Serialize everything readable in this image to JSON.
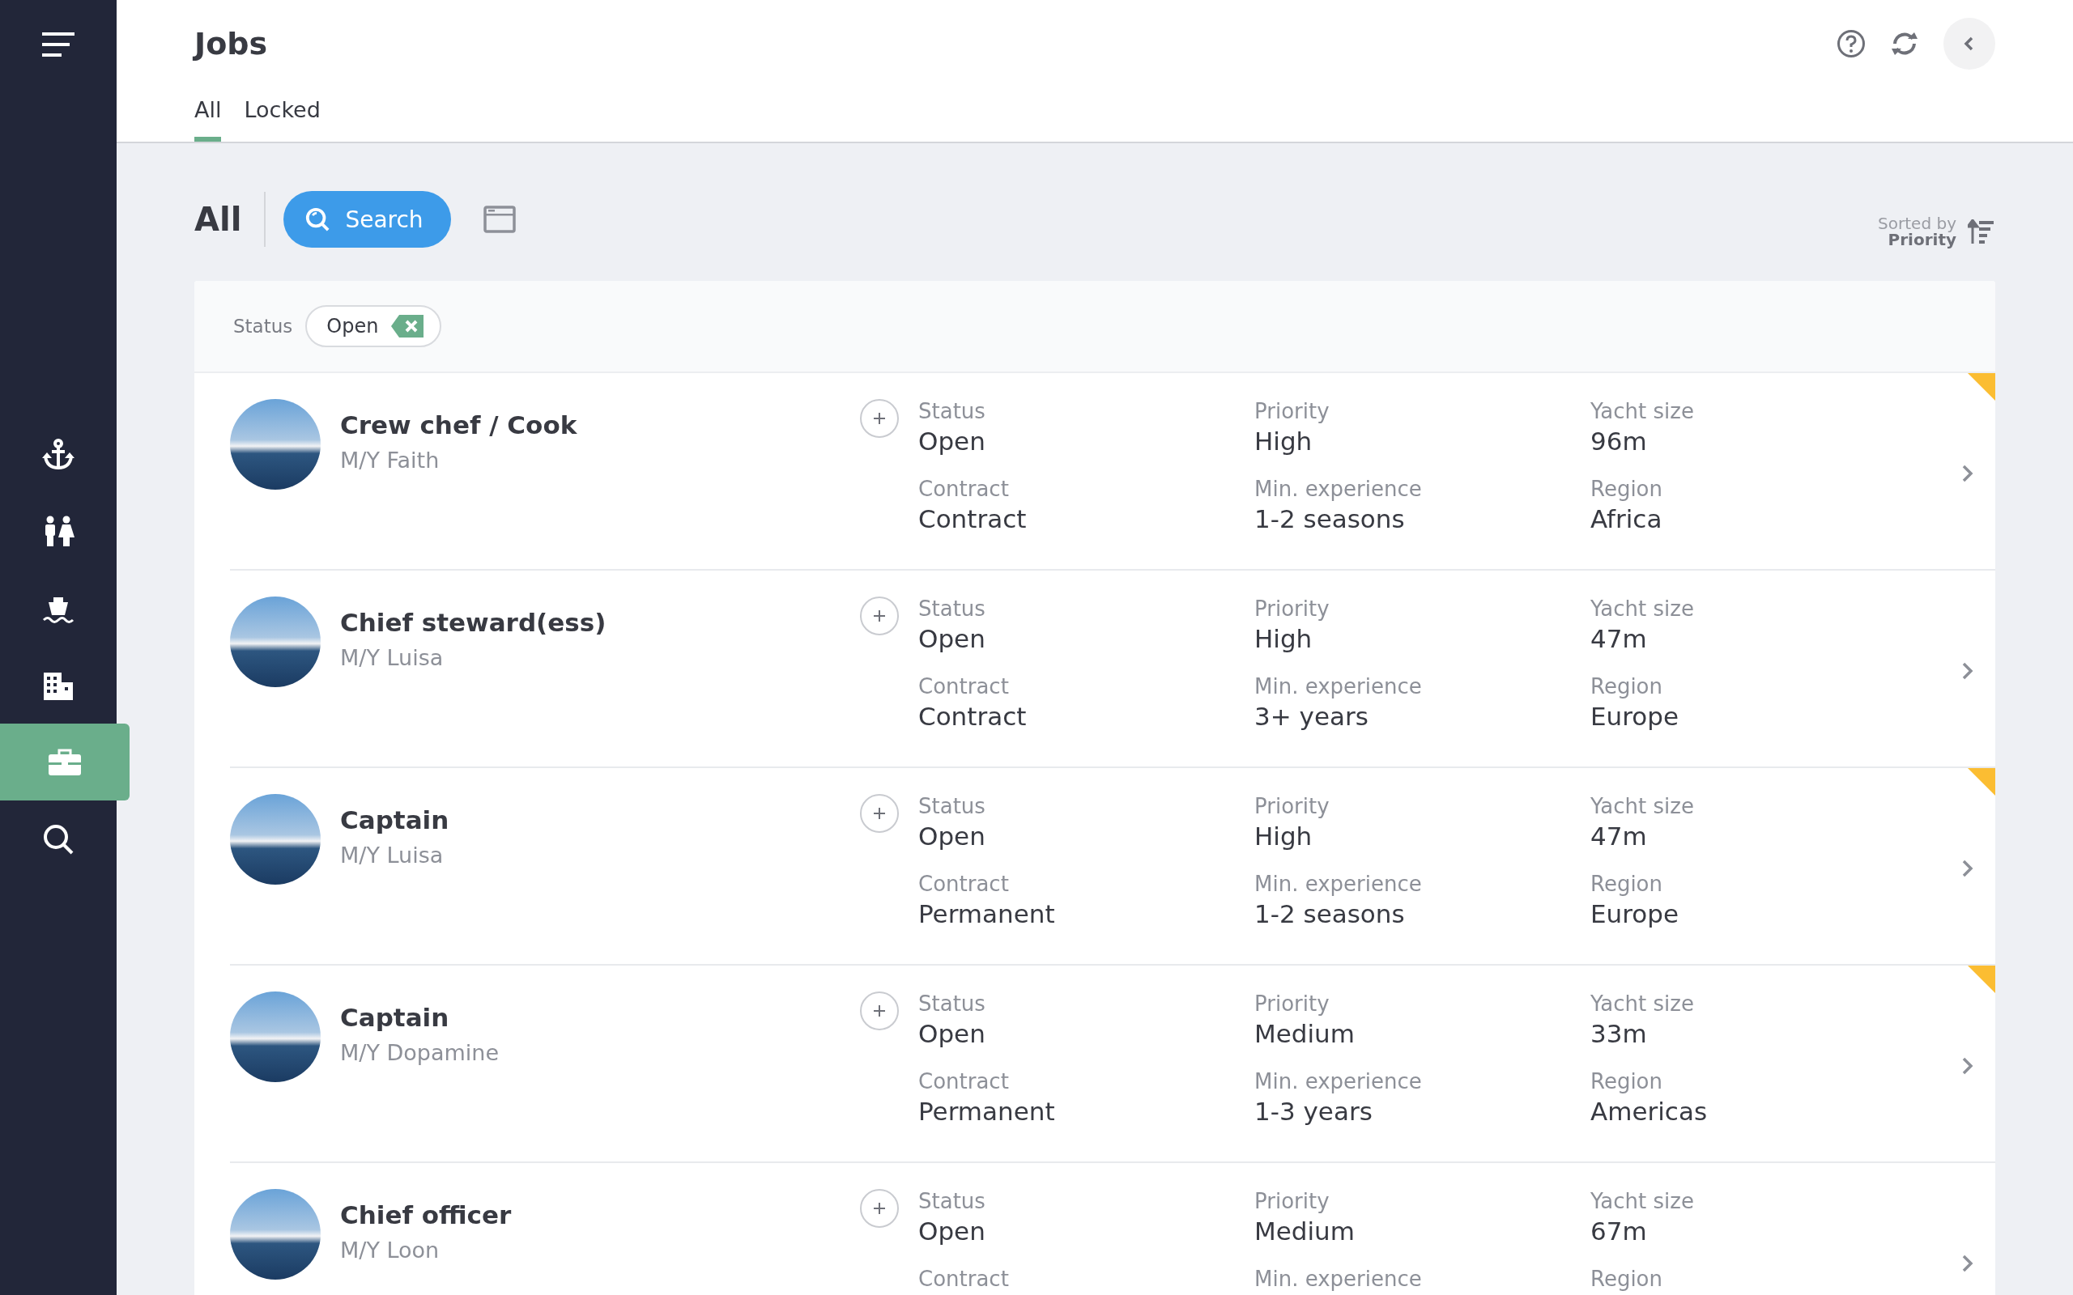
{
  "sidebar": {
    "items": [
      {
        "selected": false
      },
      {
        "selected": false
      },
      {
        "selected": false
      },
      {
        "selected": false
      },
      {
        "selected": true
      },
      {
        "selected": false
      }
    ]
  },
  "header": {
    "title": "Jobs",
    "tabs": [
      {
        "label": "All",
        "selected": true
      },
      {
        "label": "Locked",
        "selected": false
      }
    ]
  },
  "toolbar": {
    "heading": "All",
    "search_button": "Search",
    "sort_label": "Sorted by",
    "sort_value": "Priority"
  },
  "filters": [
    {
      "label": "Status",
      "value": "Open"
    }
  ],
  "jobs": [
    {
      "title": "Crew chef / Cook",
      "yacht": "M/Y Faith",
      "flagged": true,
      "fields": [
        {
          "label": "Status",
          "value": "Open"
        },
        {
          "label": "Priority",
          "value": "High"
        },
        {
          "label": "Yacht size",
          "value": "96m"
        },
        {
          "label": "Contract",
          "value": "Contract"
        },
        {
          "label": "Min. experience",
          "value": "1-2 seasons"
        },
        {
          "label": "Region",
          "value": "Africa"
        }
      ]
    },
    {
      "title": "Chief steward(ess)",
      "yacht": "M/Y Luisa",
      "flagged": false,
      "fields": [
        {
          "label": "Status",
          "value": "Open"
        },
        {
          "label": "Priority",
          "value": "High"
        },
        {
          "label": "Yacht size",
          "value": "47m"
        },
        {
          "label": "Contract",
          "value": "Contract"
        },
        {
          "label": "Min. experience",
          "value": "3+ years"
        },
        {
          "label": "Region",
          "value": "Europe"
        }
      ]
    },
    {
      "title": "Captain",
      "yacht": "M/Y Luisa",
      "flagged": true,
      "fields": [
        {
          "label": "Status",
          "value": "Open"
        },
        {
          "label": "Priority",
          "value": "High"
        },
        {
          "label": "Yacht size",
          "value": "47m"
        },
        {
          "label": "Contract",
          "value": "Permanent"
        },
        {
          "label": "Min. experience",
          "value": "1-2 seasons"
        },
        {
          "label": "Region",
          "value": "Europe"
        }
      ]
    },
    {
      "title": "Captain",
      "yacht": "M/Y Dopamine",
      "flagged": true,
      "fields": [
        {
          "label": "Status",
          "value": "Open"
        },
        {
          "label": "Priority",
          "value": "Medium"
        },
        {
          "label": "Yacht size",
          "value": "33m"
        },
        {
          "label": "Contract",
          "value": "Permanent"
        },
        {
          "label": "Min. experience",
          "value": "1-3 years"
        },
        {
          "label": "Region",
          "value": "Americas"
        }
      ]
    },
    {
      "title": "Chief officer",
      "yacht": "M/Y Loon",
      "flagged": false,
      "fields": [
        {
          "label": "Status",
          "value": "Open"
        },
        {
          "label": "Priority",
          "value": "Medium"
        },
        {
          "label": "Yacht size",
          "value": "67m"
        },
        {
          "label": "Contract"
        },
        {
          "label": "Min. experience"
        },
        {
          "label": "Region"
        }
      ]
    }
  ]
}
